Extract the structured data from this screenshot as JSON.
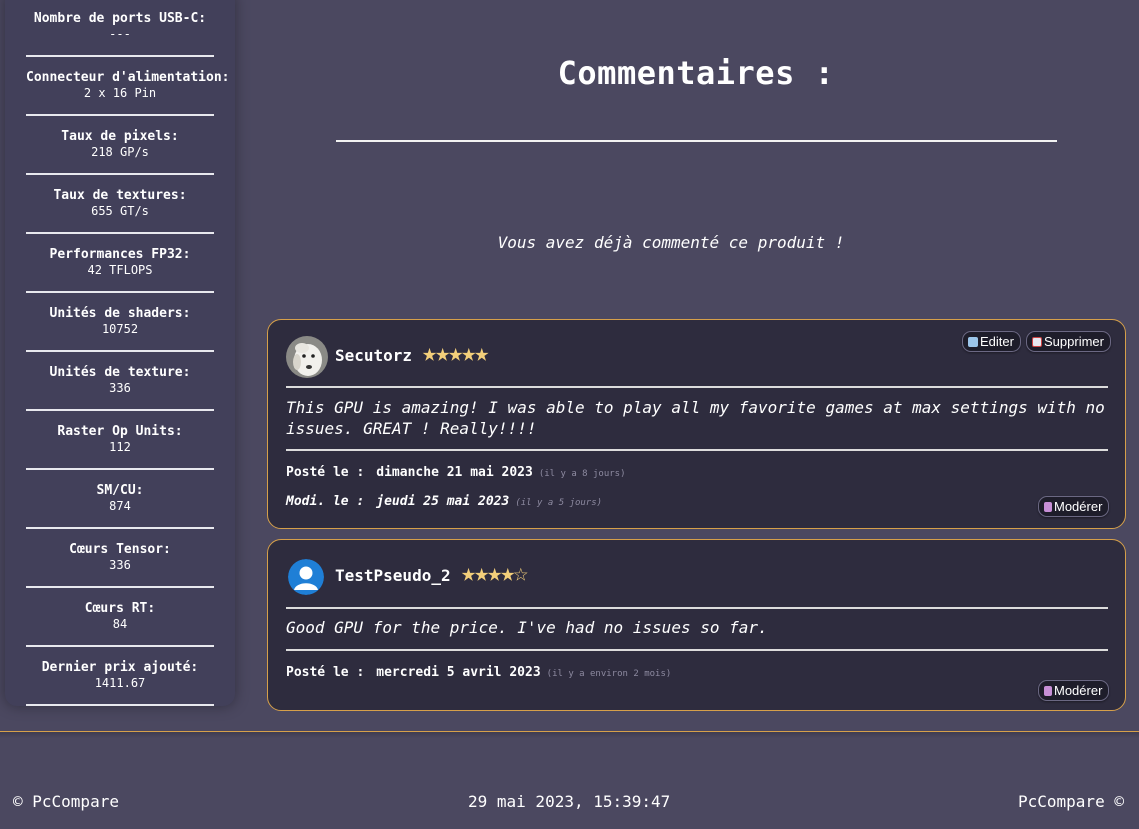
{
  "specs": [
    {
      "label": "Nombre de ports USB-C:",
      "value": "---"
    },
    {
      "label": "Connecteur d'alimentation:",
      "value": "2 x 16 Pin"
    },
    {
      "label": "Taux de pixels:",
      "value": "218 GP/s"
    },
    {
      "label": "Taux de textures:",
      "value": "655 GT/s"
    },
    {
      "label": "Performances FP32:",
      "value": "42 TFLOPS"
    },
    {
      "label": "Unités de shaders:",
      "value": "10752"
    },
    {
      "label": "Unités de texture:",
      "value": "336"
    },
    {
      "label": "Raster Op Units:",
      "value": "112"
    },
    {
      "label": "SM/CU:",
      "value": "874"
    },
    {
      "label": "Cœurs Tensor:",
      "value": "336"
    },
    {
      "label": "Cœurs RT:",
      "value": "84"
    },
    {
      "label": "Dernier prix ajouté:",
      "value": "1411.67"
    }
  ],
  "main": {
    "title": "Commentaires :",
    "notice": "Vous avez déjà commenté ce produit !"
  },
  "comments": [
    {
      "pseudo": "Secutorz",
      "rating": 5,
      "text": "This GPU is amazing! I was able to play all my favorite games at max settings with no issues. GREAT ! Really!!!!",
      "posted_label": "Posté le :",
      "posted_date": "dimanche 21 mai 2023",
      "posted_rel": "(il y a 8 jours)",
      "modified_label": "Modi. le :",
      "modified_date": "jeudi 25 mai 2023",
      "modified_rel": "(il y a 5 jours)",
      "edit_label": "Editer",
      "delete_label": "Supprimer",
      "moderate_label": "Modérer"
    },
    {
      "pseudo": "TestPseudo_2",
      "rating": 4,
      "text": "Good GPU for the price. I've had no issues so far.",
      "posted_label": "Posté le :",
      "posted_date": "mercredi 5 avril 2023",
      "posted_rel": "(il y a environ 2 mois)",
      "moderate_label": "Modérer"
    }
  ],
  "footer": {
    "left": "© PcCompare",
    "center": "29 mai 2023, 15:39:47",
    "right": "PcCompare ©"
  },
  "colors": {
    "background": "#4b4860",
    "card": "#2e2c3e",
    "card_border": "#d6a04a",
    "star": "#f3cf7a"
  }
}
